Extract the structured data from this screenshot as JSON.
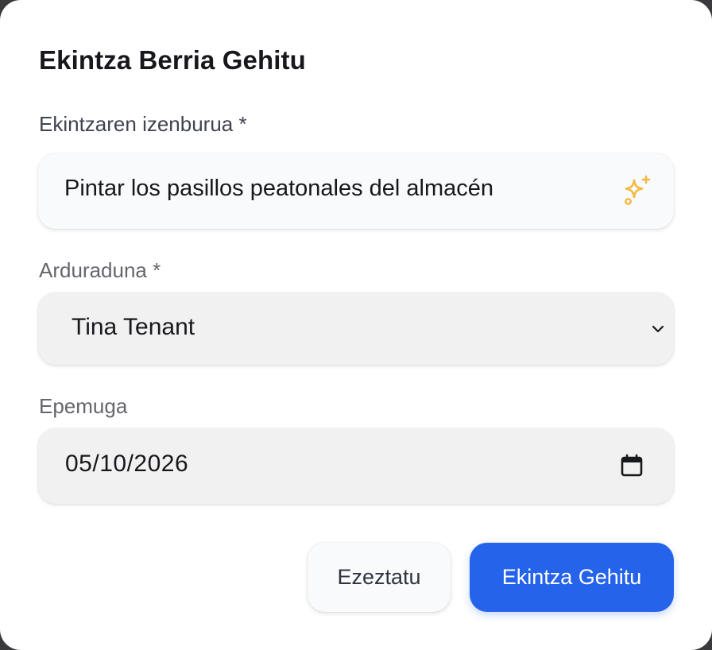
{
  "dialog": {
    "title": "Ekintza Berria Gehitu"
  },
  "form": {
    "title_field": {
      "label": "Ekintzaren izenburua *",
      "value": "Pintar los pasillos peatonales del almacén",
      "icon": "sparkles-icon"
    },
    "assignee_field": {
      "label": "Arduraduna *",
      "selected": "Tina Tenant",
      "icon": "chevron-down-icon"
    },
    "due_date_field": {
      "label": "Epemuga",
      "value": "05/10/2026",
      "icon": "calendar-icon"
    }
  },
  "actions": {
    "cancel_label": "Ezeztatu",
    "submit_label": "Ekintza Gehitu"
  },
  "colors": {
    "accent": "#2563eb",
    "sparkle": "#f5b942",
    "text": "#17181c"
  }
}
